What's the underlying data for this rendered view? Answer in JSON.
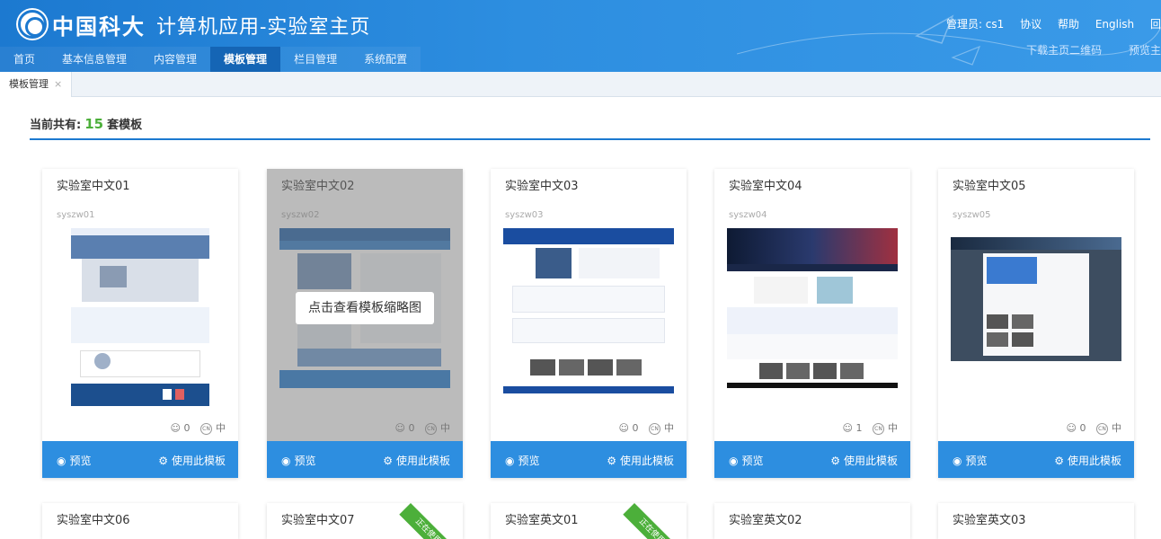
{
  "header": {
    "logo_text": "中国科大",
    "app_title": "计算机应用-实验室主页",
    "admin": "管理员: cs1",
    "links": [
      "协议",
      "帮助",
      "English",
      "回"
    ],
    "sub_links": [
      "下载主页二维码",
      "预览主"
    ]
  },
  "nav": {
    "items": [
      "首页",
      "基本信息管理",
      "内容管理",
      "模板管理",
      "栏目管理",
      "系统配置"
    ],
    "active": "模板管理"
  },
  "tabs": [
    {
      "label": "模板管理",
      "close": "×"
    }
  ],
  "summary": {
    "prefix": "当前共有:",
    "count": "15",
    "suffix": "套模板"
  },
  "cards": [
    {
      "name": "实验室中文01",
      "code": "syszw01",
      "uses": "0",
      "badge": "CN",
      "lang": "中",
      "preview": "预览",
      "use": "使用此模板"
    },
    {
      "name": "实验室中文02",
      "code": "syszw02",
      "uses": "0",
      "badge": "CN",
      "lang": "中",
      "preview": "预览",
      "use": "使用此模板",
      "hover_tip": "点击查看模板缩略图"
    },
    {
      "name": "实验室中文03",
      "code": "syszw03",
      "uses": "0",
      "badge": "CN",
      "lang": "中",
      "preview": "预览",
      "use": "使用此模板"
    },
    {
      "name": "实验室中文04",
      "code": "syszw04",
      "uses": "1",
      "badge": "CN",
      "lang": "中",
      "preview": "预览",
      "use": "使用此模板"
    },
    {
      "name": "实验室中文05",
      "code": "syszw05",
      "uses": "0",
      "badge": "CN",
      "lang": "中",
      "preview": "预览",
      "use": "使用此模板"
    }
  ],
  "row2": [
    {
      "name": "实验室中文06"
    },
    {
      "name": "实验室中文07",
      "ribbon": "正在使用"
    },
    {
      "name": "实验室英文01",
      "ribbon": "正在使用"
    },
    {
      "name": "实验室英文02"
    },
    {
      "name": "实验室英文03"
    }
  ],
  "colors": {
    "primary": "#2d8ee0",
    "header_dark": "#1c79d0",
    "accent_green": "#4caf3a"
  },
  "icons": {
    "preview": "eye-icon",
    "use": "gear-icon",
    "uses": "user-icon",
    "lang_badge": "cn-badge-icon"
  }
}
